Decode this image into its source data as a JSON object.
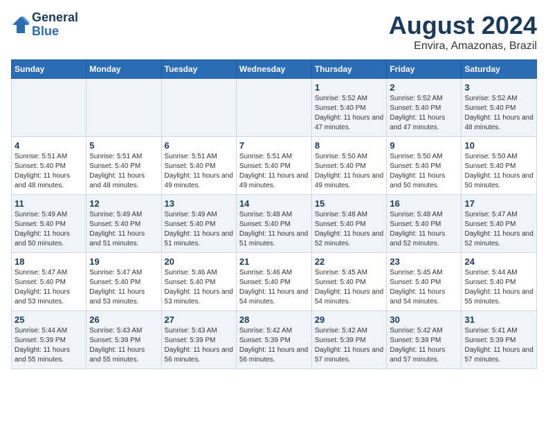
{
  "header": {
    "logo_line1": "General",
    "logo_line2": "Blue",
    "month_year": "August 2024",
    "location": "Envira, Amazonas, Brazil"
  },
  "days_of_week": [
    "Sunday",
    "Monday",
    "Tuesday",
    "Wednesday",
    "Thursday",
    "Friday",
    "Saturday"
  ],
  "weeks": [
    [
      {
        "day": "",
        "text": ""
      },
      {
        "day": "",
        "text": ""
      },
      {
        "day": "",
        "text": ""
      },
      {
        "day": "",
        "text": ""
      },
      {
        "day": "1",
        "text": "Sunrise: 5:52 AM\nSunset: 5:40 PM\nDaylight: 11 hours and 47 minutes."
      },
      {
        "day": "2",
        "text": "Sunrise: 5:52 AM\nSunset: 5:40 PM\nDaylight: 11 hours and 47 minutes."
      },
      {
        "day": "3",
        "text": "Sunrise: 5:52 AM\nSunset: 5:40 PM\nDaylight: 11 hours and 48 minutes."
      }
    ],
    [
      {
        "day": "4",
        "text": "Sunrise: 5:51 AM\nSunset: 5:40 PM\nDaylight: 11 hours and 48 minutes."
      },
      {
        "day": "5",
        "text": "Sunrise: 5:51 AM\nSunset: 5:40 PM\nDaylight: 11 hours and 48 minutes."
      },
      {
        "day": "6",
        "text": "Sunrise: 5:51 AM\nSunset: 5:40 PM\nDaylight: 11 hours and 49 minutes."
      },
      {
        "day": "7",
        "text": "Sunrise: 5:51 AM\nSunset: 5:40 PM\nDaylight: 11 hours and 49 minutes."
      },
      {
        "day": "8",
        "text": "Sunrise: 5:50 AM\nSunset: 5:40 PM\nDaylight: 11 hours and 49 minutes."
      },
      {
        "day": "9",
        "text": "Sunrise: 5:50 AM\nSunset: 5:40 PM\nDaylight: 11 hours and 50 minutes."
      },
      {
        "day": "10",
        "text": "Sunrise: 5:50 AM\nSunset: 5:40 PM\nDaylight: 11 hours and 50 minutes."
      }
    ],
    [
      {
        "day": "11",
        "text": "Sunrise: 5:49 AM\nSunset: 5:40 PM\nDaylight: 11 hours and 50 minutes."
      },
      {
        "day": "12",
        "text": "Sunrise: 5:49 AM\nSunset: 5:40 PM\nDaylight: 11 hours and 51 minutes."
      },
      {
        "day": "13",
        "text": "Sunrise: 5:49 AM\nSunset: 5:40 PM\nDaylight: 11 hours and 51 minutes."
      },
      {
        "day": "14",
        "text": "Sunrise: 5:48 AM\nSunset: 5:40 PM\nDaylight: 11 hours and 51 minutes."
      },
      {
        "day": "15",
        "text": "Sunrise: 5:48 AM\nSunset: 5:40 PM\nDaylight: 11 hours and 52 minutes."
      },
      {
        "day": "16",
        "text": "Sunrise: 5:48 AM\nSunset: 5:40 PM\nDaylight: 11 hours and 52 minutes."
      },
      {
        "day": "17",
        "text": "Sunrise: 5:47 AM\nSunset: 5:40 PM\nDaylight: 11 hours and 52 minutes."
      }
    ],
    [
      {
        "day": "18",
        "text": "Sunrise: 5:47 AM\nSunset: 5:40 PM\nDaylight: 11 hours and 53 minutes."
      },
      {
        "day": "19",
        "text": "Sunrise: 5:47 AM\nSunset: 5:40 PM\nDaylight: 11 hours and 53 minutes."
      },
      {
        "day": "20",
        "text": "Sunrise: 5:46 AM\nSunset: 5:40 PM\nDaylight: 11 hours and 53 minutes."
      },
      {
        "day": "21",
        "text": "Sunrise: 5:46 AM\nSunset: 5:40 PM\nDaylight: 11 hours and 54 minutes."
      },
      {
        "day": "22",
        "text": "Sunrise: 5:45 AM\nSunset: 5:40 PM\nDaylight: 11 hours and 54 minutes."
      },
      {
        "day": "23",
        "text": "Sunrise: 5:45 AM\nSunset: 5:40 PM\nDaylight: 11 hours and 54 minutes."
      },
      {
        "day": "24",
        "text": "Sunrise: 5:44 AM\nSunset: 5:40 PM\nDaylight: 11 hours and 55 minutes."
      }
    ],
    [
      {
        "day": "25",
        "text": "Sunrise: 5:44 AM\nSunset: 5:39 PM\nDaylight: 11 hours and 55 minutes."
      },
      {
        "day": "26",
        "text": "Sunrise: 5:43 AM\nSunset: 5:39 PM\nDaylight: 11 hours and 55 minutes."
      },
      {
        "day": "27",
        "text": "Sunrise: 5:43 AM\nSunset: 5:39 PM\nDaylight: 11 hours and 56 minutes."
      },
      {
        "day": "28",
        "text": "Sunrise: 5:42 AM\nSunset: 5:39 PM\nDaylight: 11 hours and 56 minutes."
      },
      {
        "day": "29",
        "text": "Sunrise: 5:42 AM\nSunset: 5:39 PM\nDaylight: 11 hours and 57 minutes."
      },
      {
        "day": "30",
        "text": "Sunrise: 5:42 AM\nSunset: 5:39 PM\nDaylight: 11 hours and 57 minutes."
      },
      {
        "day": "31",
        "text": "Sunrise: 5:41 AM\nSunset: 5:39 PM\nDaylight: 11 hours and 57 minutes."
      }
    ]
  ]
}
